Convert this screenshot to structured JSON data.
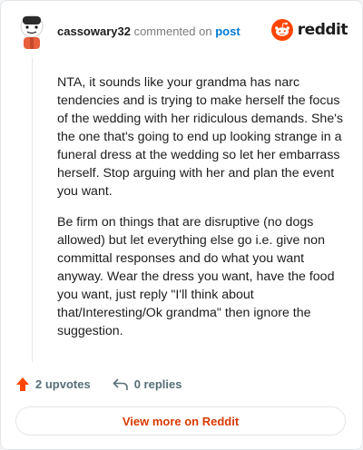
{
  "comment": {
    "username": "cassowary32",
    "action_text": "commented on",
    "post_link": "post",
    "paragraphs": [
      "NTA, it sounds like your grandma has narc tendencies and is trying to make herself the focus of the wedding with her ridiculous demands. She's the one that's going to end up looking strange in a funeral dress at the wedding so let her embarrass herself. Stop arguing with her and plan the event you want.",
      "Be firm on things that are disruptive (no dogs allowed) but let everything else go i.e. give non committal responses and do what you want anyway. Wear the dress you want, have the food you want, just reply \"I'll think about that/Interesting/Ok grandma\" then ignore the suggestion."
    ],
    "upvotes": "2 upvotes",
    "replies": "0 replies"
  },
  "brand": {
    "name": "reddit",
    "color": "#ff4500"
  },
  "footer": {
    "view_more_label": "View more on Reddit"
  },
  "icons": {
    "avatar": "snoo-avatar-icon",
    "logo": "reddit-logo-icon",
    "upvote": "upvote-arrow-icon",
    "reply": "reply-arrow-icon"
  }
}
